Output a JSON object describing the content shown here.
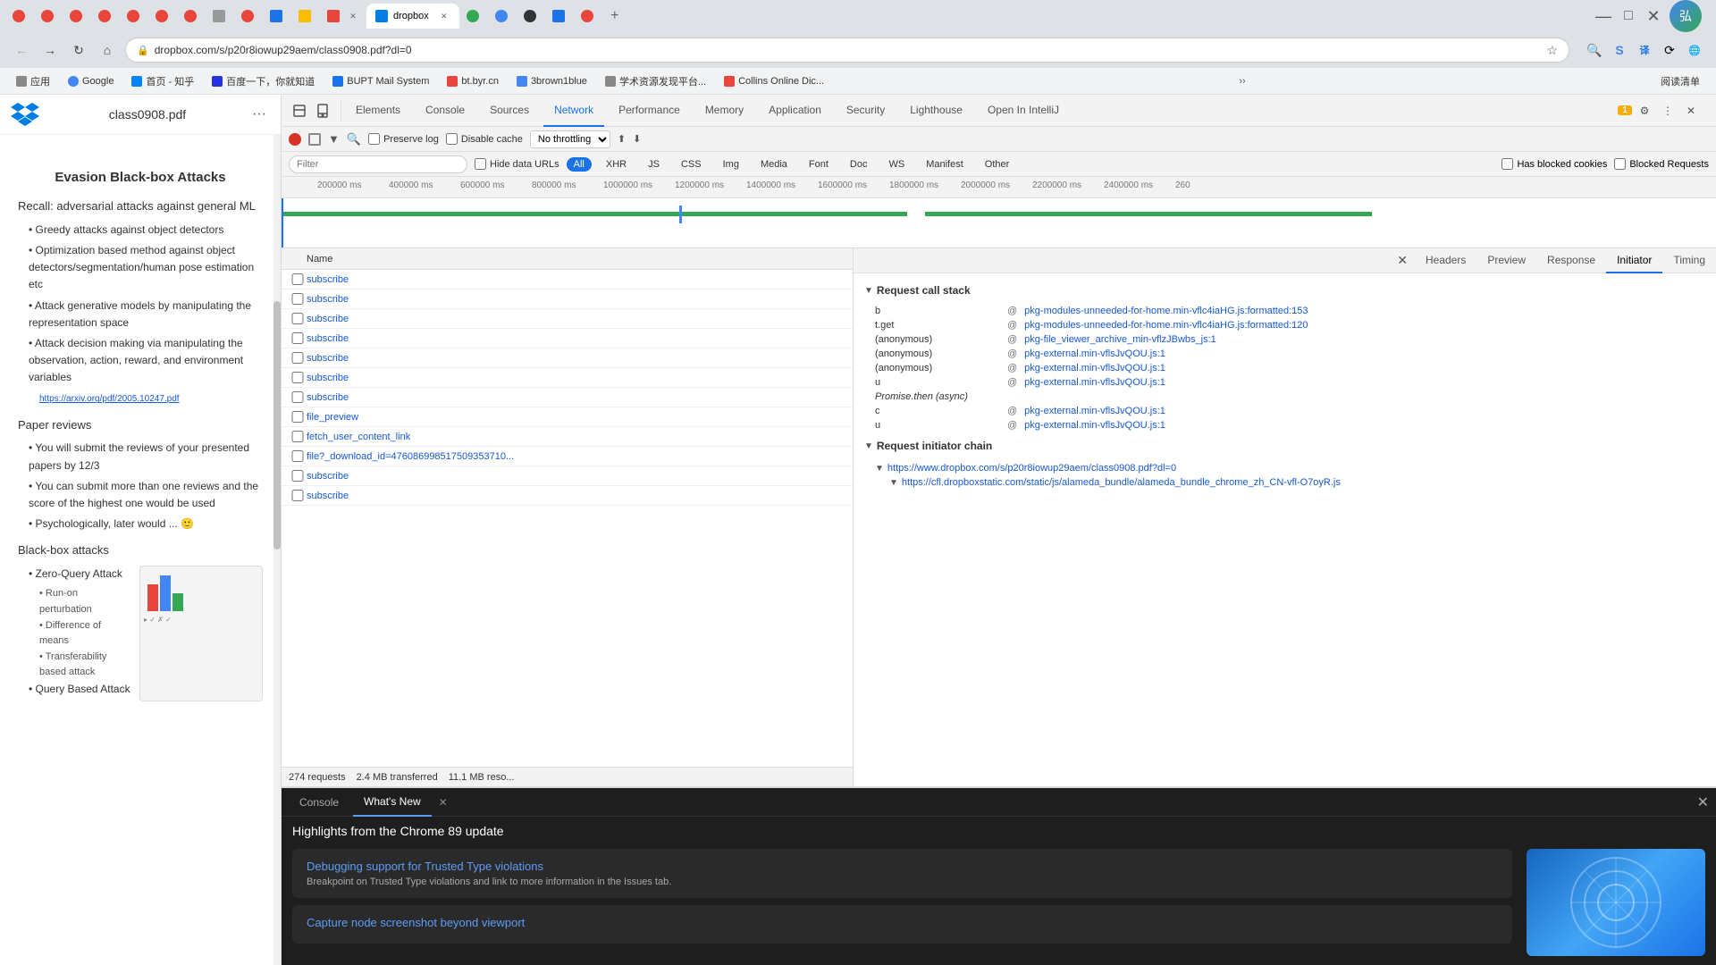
{
  "browser": {
    "tabs": [
      {
        "id": "t1",
        "favicon_color": "#e8453c",
        "label": "",
        "active": false
      },
      {
        "id": "t2",
        "favicon_color": "#e8453c",
        "label": "",
        "active": false
      },
      {
        "id": "t3",
        "favicon_color": "#e8453c",
        "label": "",
        "active": false
      },
      {
        "id": "t4",
        "favicon_color": "#e8453c",
        "label": "",
        "active": false
      },
      {
        "id": "t5",
        "favicon_color": "#e8453c",
        "label": "",
        "active": false
      },
      {
        "id": "t6",
        "favicon_color": "#e8453c",
        "label": "",
        "active": false
      },
      {
        "id": "t7",
        "favicon_color": "#e8453c",
        "label": "",
        "active": false
      },
      {
        "id": "t8",
        "favicon_color": "#999",
        "label": "",
        "active": false
      },
      {
        "id": "t9",
        "favicon_color": "#e8453c",
        "label": "",
        "active": false
      },
      {
        "id": "t10",
        "favicon_color": "#1a73e8",
        "label": "",
        "active": false
      },
      {
        "id": "t11",
        "favicon_color": "#34a853",
        "label": "",
        "active": false
      },
      {
        "id": "t12",
        "favicon_color": "#e8453c",
        "label": "",
        "active": false,
        "close": true
      },
      {
        "id": "t13",
        "favicon_color": "#00acd9",
        "label": "dropbox",
        "active": true,
        "close": true
      }
    ],
    "add_tab_label": "+",
    "url": "dropbox.com/s/p20r8iowup29aem/class0908.pdf?dl=0",
    "url_full": "dropbox.com/s/p20r8iowup29aem/class0908.pdf?dl=0",
    "bookmarks": [
      {
        "label": "应用",
        "favicon_color": "#888"
      },
      {
        "label": "Google",
        "favicon_color": "#4285f4"
      },
      {
        "label": "首页 - 知乎",
        "favicon_color": "#0084ff"
      },
      {
        "label": "百度一下，你就知道",
        "favicon_color": "#2932e1"
      },
      {
        "label": "BUPT Mail System",
        "favicon_color": "#1a73e8"
      },
      {
        "label": "bt.byr.cn",
        "favicon_color": "#e8453c"
      },
      {
        "label": "3brown1blue",
        "favicon_color": "#4285f4"
      },
      {
        "label": "学术资源发现平台...",
        "favicon_color": "#888"
      },
      {
        "label": "Collins Online Dic...",
        "favicon_color": "#e8453c"
      },
      {
        "label": "more",
        "favicon_color": "#555"
      }
    ]
  },
  "pdf": {
    "title": "class0908.pdf",
    "menu_btn": "···",
    "sections": [
      {
        "heading": "Evasion Black-box Attacks",
        "type": "heading"
      },
      {
        "heading": "Recall: adversarial attacks against general ML",
        "type": "subheading"
      },
      {
        "bullets": [
          "Greedy attacks against object detectors",
          "Optimization based method against object detectors/segmentation/human pose estimation etc",
          "Attack generative models by manipulating the representation space",
          "Attack decision making via manipulating the observation, action, reward, and environment variables"
        ],
        "sublink": "https://arxiv.org/pdf/2005.10247.pdf"
      },
      {
        "heading": "Paper reviews",
        "type": "subheading"
      },
      {
        "bullets": [
          "You will submit the reviews of your presented papers by 12/3",
          "You can submit more than one reviews and the score of the highest one would be used",
          "Psychologically, later would ... 🙂"
        ]
      },
      {
        "heading": "Black-box attacks",
        "type": "subheading"
      },
      {
        "bullets": [
          "Zero-Query Attack",
          "Run-on perturbation",
          "Difference of means",
          "Transferability based attack",
          "Query Based Attack"
        ],
        "has_image": true
      }
    ]
  },
  "devtools": {
    "tabs": [
      "Elements",
      "Console",
      "Sources",
      "Network",
      "Performance",
      "Memory",
      "Application",
      "Security",
      "Lighthouse",
      "Open In IntelliJ"
    ],
    "active_tab": "Network",
    "warning_count": "1",
    "toolbar": {
      "record_title": "Record",
      "stop_title": "Stop",
      "filter_title": "Filter",
      "search_title": "Search",
      "preserve_log": "Preserve log",
      "disable_cache": "Disable cache",
      "throttle_label": "No throttling",
      "upload_title": "Import",
      "download_title": "Export"
    },
    "filter_types": [
      "All",
      "XHR",
      "JS",
      "CSS",
      "Img",
      "Media",
      "Font",
      "Doc",
      "WS",
      "Manifest",
      "Other"
    ],
    "active_filter_type": "All",
    "has_blocked_cookies": "Has blocked cookies",
    "blocked_requests": "Blocked Requests",
    "hide_data_urls": "Hide data URLs",
    "filter_placeholder": "Filter"
  },
  "timeline": {
    "labels": [
      "200000 ms",
      "400000 ms",
      "600000 ms",
      "800000 ms",
      "1000000 ms",
      "1200000 ms",
      "1400000 ms",
      "1600000 ms",
      "1800000 ms",
      "2000000 ms",
      "2200000 ms",
      "2400000 ms",
      "260"
    ]
  },
  "requests": {
    "column_name": "Name",
    "items": [
      {
        "name": "subscribe",
        "type": "xhr"
      },
      {
        "name": "subscribe",
        "type": "xhr"
      },
      {
        "name": "subscribe",
        "type": "xhr"
      },
      {
        "name": "subscribe",
        "type": "xhr"
      },
      {
        "name": "subscribe",
        "type": "xhr"
      },
      {
        "name": "subscribe",
        "type": "xhr"
      },
      {
        "name": "subscribe",
        "type": "xhr"
      },
      {
        "name": "file_preview",
        "type": "doc"
      },
      {
        "name": "fetch_user_content_link",
        "type": "xhr"
      },
      {
        "name": "file?_download_id=476086998517509353710...",
        "type": "xhr"
      },
      {
        "name": "subscribe",
        "type": "xhr"
      },
      {
        "name": "subscribe",
        "type": "xhr"
      }
    ],
    "footer": {
      "requests_count": "274 requests",
      "transferred": "2.4 MB transferred",
      "resources": "11.1 MB reso..."
    }
  },
  "detail": {
    "tabs": [
      "Headers",
      "Preview",
      "Response",
      "Initiator",
      "Timing"
    ],
    "active_tab": "Initiator",
    "close_btn": "×",
    "request_call_stack": {
      "title": "Request call stack",
      "items": [
        {
          "fn": "b",
          "at": "@",
          "link": "pkg-modules-unneeded-for-home.min-vflc4iaHG.js:formatted:153"
        },
        {
          "fn": "t.get",
          "at": "@",
          "link": "pkg-modules-unneeded-for-home.min-vflc4iaHG.js:formatted:120"
        },
        {
          "fn": "(anonymous)",
          "at": "@",
          "link": "pkg-file_viewer_archive_min-vflzJBwbs_js:1"
        },
        {
          "fn": "(anonymous)",
          "at": "@",
          "link": "pkg-external.min-vflsJvQOU.js:1"
        },
        {
          "fn": "(anonymous)",
          "at": "@",
          "link": "pkg-external.min-vflsJvQOU.js:1"
        },
        {
          "fn": "u",
          "at": "@",
          "link": "pkg-external.min-vflsJvQOU.js:1"
        },
        {
          "fn": "Promise.then (async)",
          "at": "",
          "link": ""
        },
        {
          "fn": "c",
          "at": "@",
          "link": "pkg-external.min-vflsJvQOU.js:1"
        },
        {
          "fn": "u",
          "at": "@",
          "link": "pkg-external.min-vflsJvQOU.js:1"
        }
      ]
    },
    "request_initiator_chain": {
      "title": "Request initiator chain",
      "items": [
        {
          "url": "https://www.dropbox.com/s/p20r8iowup29aem/class0908.pdf?dl=0",
          "indent": 0
        },
        {
          "url": "https://cfl.dropboxstatic.com/static/js/alameda_bundle/alameda_bundle_chrome_zh_CN-vfl-O7oyR.js",
          "indent": 1
        }
      ]
    }
  },
  "bottom_drawer": {
    "tabs": [
      "Console",
      "What's New"
    ],
    "active_tab": "What's New",
    "close_btn": "×",
    "title": "Highlights from the Chrome 89 update",
    "cards": [
      {
        "title": "Debugging support for Trusted Type violations",
        "desc": "Breakpoint on Trusted Type violations and link to more information in the Issues tab."
      },
      {
        "title": "Capture node screenshot beyond viewport",
        "desc": ""
      }
    ]
  }
}
